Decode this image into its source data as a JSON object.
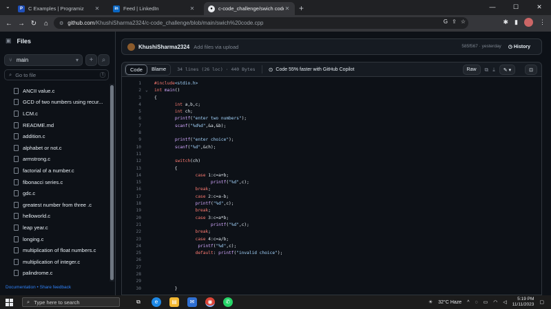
{
  "browser": {
    "tabs": [
      {
        "title": "C Examples | Programiz",
        "favicon": "programiz-icon",
        "active": false
      },
      {
        "title": "Feed | LinkedIn",
        "favicon": "linkedin-icon",
        "active": false
      },
      {
        "title": "c-code_challenge/swich code.c",
        "favicon": "github-icon",
        "active": true
      }
    ],
    "new_tab": "+",
    "url_host": "github.com",
    "url_path": "/KhushiSharma2324/c-code_challenge/blob/main/swich%20code.cpp"
  },
  "sidebar": {
    "title": "Files",
    "branch": "main",
    "add": "+",
    "search_placeholder": "Go to file",
    "search_kbd": "t",
    "files": [
      "ANCII value.c",
      "GCD of two numbers using recur...",
      "LCM.c",
      "README.md",
      "addition.c",
      "alphabet or not.c",
      "armstrong.c",
      "factorial of a number.c",
      "fibonacci series.c",
      "gdc.c",
      "greatest number from three .c",
      "helloworld.c",
      "leap year.c",
      "longing.c",
      "multiplication of float numbers.c",
      "multiplication of integer.c",
      "palindrome.c"
    ],
    "footer": "Documentation • Share feedback"
  },
  "commit": {
    "author": "KhushiSharma2324",
    "message": "Add files via upload",
    "hash": "585f567 · yesterday",
    "history": "History"
  },
  "filehead": {
    "code_tab": "Code",
    "blame_tab": "Blame",
    "stats": "34 lines (26 loc) · 440 Bytes",
    "copilot": "Code 55% faster with GitHub Copilot",
    "raw": "Raw"
  },
  "code_lines": [
    {
      "n": "1",
      "fold": "",
      "t": "#include<stdio.h>"
    },
    {
      "n": "2",
      "fold": "⌄",
      "t": "int main()"
    },
    {
      "n": "3",
      "fold": "",
      "t": "{"
    },
    {
      "n": "4",
      "fold": "",
      "t": "        int a,b,c;"
    },
    {
      "n": "5",
      "fold": "",
      "t": "        int ch;"
    },
    {
      "n": "6",
      "fold": "",
      "t": "        printf(\"enter two numbers\");"
    },
    {
      "n": "7",
      "fold": "",
      "t": "        scanf(\"%d%d\",&a,&b);"
    },
    {
      "n": "8",
      "fold": "",
      "t": ""
    },
    {
      "n": "9",
      "fold": "",
      "t": "        printf(\"enter choice\");"
    },
    {
      "n": "10",
      "fold": "",
      "t": "        scanf(\"%d\",&ch);"
    },
    {
      "n": "11",
      "fold": "",
      "t": ""
    },
    {
      "n": "12",
      "fold": "",
      "t": "        switch(ch)"
    },
    {
      "n": "13",
      "fold": "",
      "t": "        {"
    },
    {
      "n": "14",
      "fold": "",
      "t": "                case 1:c=a+b;"
    },
    {
      "n": "15",
      "fold": "",
      "t": "                      printf(\"%d\",c);"
    },
    {
      "n": "16",
      "fold": "",
      "t": "                break;"
    },
    {
      "n": "17",
      "fold": "",
      "t": "                case 2:c=a-b;"
    },
    {
      "n": "18",
      "fold": "",
      "t": "                printf(\"%d\",c);"
    },
    {
      "n": "19",
      "fold": "",
      "t": "                break;"
    },
    {
      "n": "20",
      "fold": "",
      "t": "                case 3:c=a*b;"
    },
    {
      "n": "21",
      "fold": "",
      "t": "                      printf(\"%d\",c);"
    },
    {
      "n": "22",
      "fold": "",
      "t": "                break;"
    },
    {
      "n": "23",
      "fold": "",
      "t": "                case 4:c=a/b;"
    },
    {
      "n": "24",
      "fold": "",
      "t": "                 printf(\"%d\",c);"
    },
    {
      "n": "25",
      "fold": "",
      "t": "                default: printf(\"invalid choice\");"
    },
    {
      "n": "26",
      "fold": "",
      "t": ""
    },
    {
      "n": "27",
      "fold": "",
      "t": ""
    },
    {
      "n": "28",
      "fold": "",
      "t": ""
    },
    {
      "n": "29",
      "fold": "",
      "t": ""
    },
    {
      "n": "30",
      "fold": "",
      "t": "        }"
    }
  ],
  "taskbar": {
    "search_placeholder": "Type here to search",
    "weather": "32°C  Haze",
    "time": "5:19 PM",
    "date": "11/11/2023"
  }
}
